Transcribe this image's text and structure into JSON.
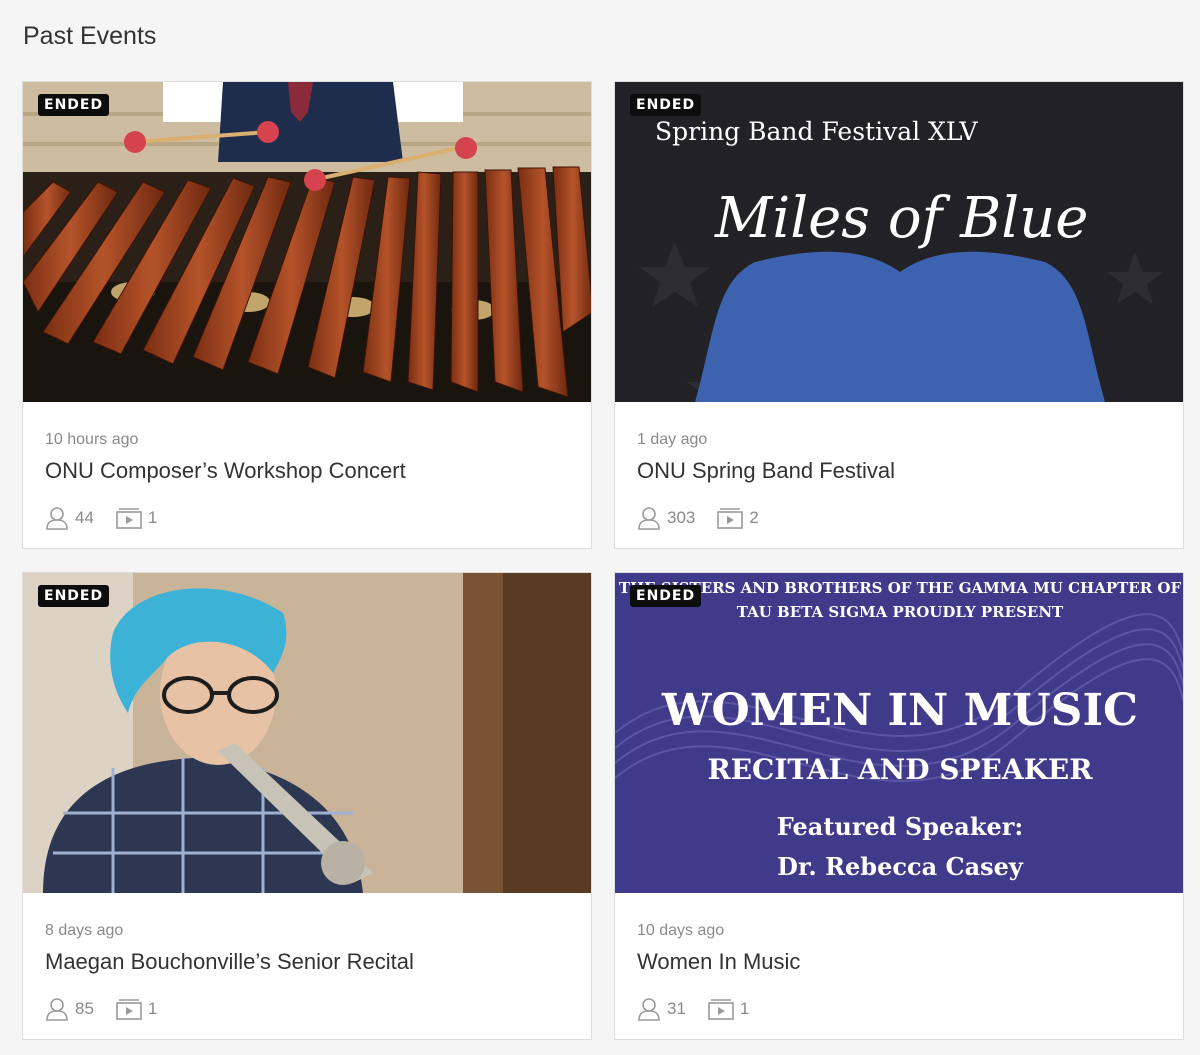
{
  "page": {
    "title": "Past Events"
  },
  "events": [
    {
      "badge": "ENDED",
      "time": "10 hours ago",
      "title": "ONU Composer’s Workshop Concert",
      "viewers": "44",
      "videos": "1"
    },
    {
      "badge": "ENDED",
      "time": "1 day ago",
      "title": "ONU Spring Band Festival",
      "viewers": "303",
      "videos": "2",
      "poster": {
        "line1": "Spring Band Festival XLV",
        "line2": "Miles of Blue"
      }
    },
    {
      "badge": "ENDED",
      "time": "8 days ago",
      "title": "Maegan Bouchonville’s Senior Recital",
      "viewers": "85",
      "videos": "1"
    },
    {
      "badge": "ENDED",
      "time": "10 days ago",
      "title": "Women In Music",
      "viewers": "31",
      "videos": "1",
      "poster": {
        "top1": "THE SISTERS AND BROTHERS OF THE GAMMA MU CHAPTER OF",
        "top2": "TAU BETA SIGMA PROUDLY PRESENT",
        "heading": "WOMEN IN MUSIC",
        "sub": "RECITAL AND SPEAKER",
        "feat1": "Featured Speaker:",
        "feat2": "Dr. Rebecca Casey"
      }
    }
  ],
  "icons": {
    "viewers": "person-icon",
    "videos": "video-icon"
  },
  "colors": {
    "background": "#f5f5f5",
    "badge": "#0d0d0d",
    "poster_blue": "#3f3a8a"
  }
}
